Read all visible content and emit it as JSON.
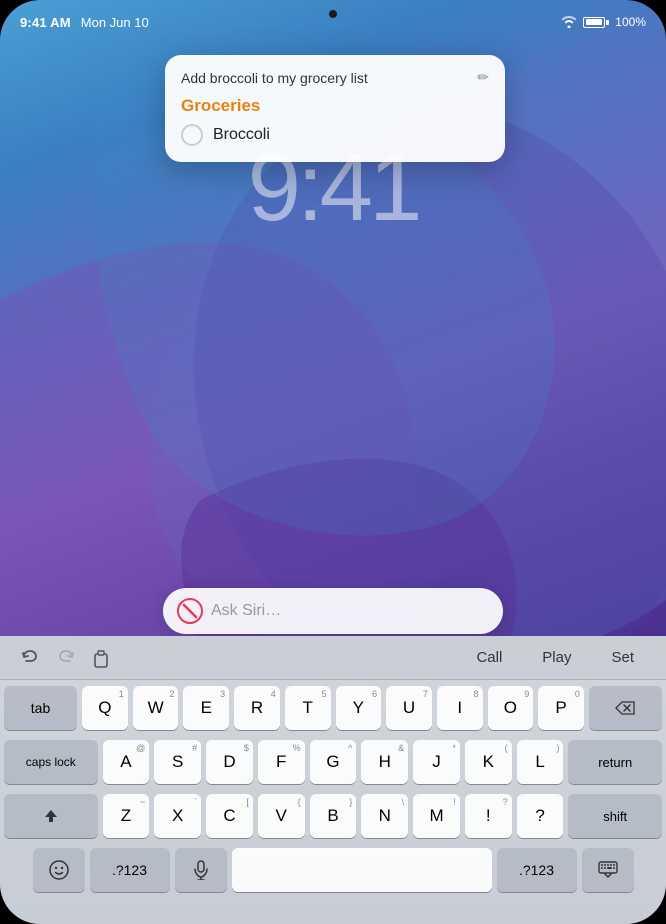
{
  "status_bar": {
    "time": "9:41 AM",
    "date": "Mon Jun 10",
    "wifi_icon": "wifi-icon",
    "battery_icon": "battery-icon",
    "battery_percent": "100%"
  },
  "notification_card": {
    "header_text": "Add broccoli to my grocery list",
    "edit_icon": "✏",
    "list_name": "Groceries",
    "item_name": "Broccoli"
  },
  "lock_screen": {
    "time": "9:41"
  },
  "siri_bar": {
    "placeholder": "Ask Siri…"
  },
  "keyboard_toolbar": {
    "undo_icon": "undo-icon",
    "redo_icon": "redo-icon",
    "paste_icon": "paste-icon",
    "call_label": "Call",
    "play_label": "Play",
    "set_label": "Set"
  },
  "keyboard": {
    "row1": [
      "Q",
      "W",
      "E",
      "R",
      "T",
      "Y",
      "U",
      "I",
      "O",
      "P"
    ],
    "row2": [
      "A",
      "S",
      "D",
      "F",
      "G",
      "H",
      "J",
      "K",
      "L"
    ],
    "row3": [
      "Z",
      "X",
      "C",
      "V",
      "B",
      "N",
      "M"
    ],
    "row1_subs": [
      "1",
      "2",
      "3",
      "4",
      "5",
      "6",
      "7",
      "8",
      "9",
      "0"
    ],
    "row2_subs": [
      "@",
      "#",
      "$",
      "%",
      "^",
      "&",
      "*",
      "(",
      ")",
      "-"
    ],
    "row3_subs": [
      "~",
      "`",
      "[",
      "{",
      "}",
      "\\",
      "|",
      "!",
      "?"
    ],
    "tab_label": "tab",
    "caps_lock_label": "caps lock",
    "shift_label": "shift",
    "delete_label": "delete",
    "return_label": "return",
    "emoji_icon": "emoji-icon",
    "numeric_label": ".?123",
    "mic_icon": "mic-icon",
    "space_label": "",
    "numeric_right_label": ".?123",
    "keyboard_icon": "keyboard-dismiss-icon"
  },
  "colors": {
    "siri_no": "#E8395A",
    "groceries_orange": "#E8820C",
    "wallpaper_top": "#4a9fd4",
    "wallpaper_bottom": "#2a1f6a"
  }
}
